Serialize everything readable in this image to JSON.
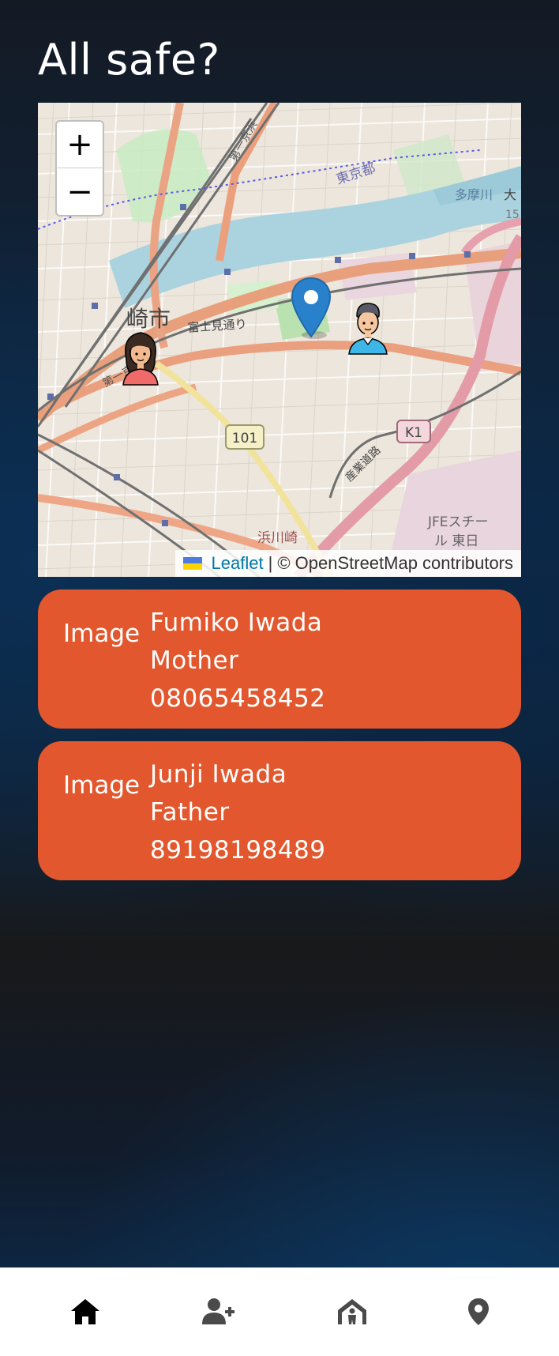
{
  "page": {
    "title": "All safe?"
  },
  "map": {
    "zoom_in_label": "+",
    "zoom_out_label": "−",
    "attribution": {
      "leaflet": "Leaflet",
      "separator": "|",
      "osm": "© OpenStreetMap contributors"
    },
    "labels": {
      "city": "崎市",
      "road_fuji": "富士見通り",
      "road_daiichi_a": "第一京浜",
      "road_daiichi_b": "第一京浜",
      "tokyo": "東京都",
      "tamagawa": "多摩川",
      "tamagawa_suffix": "大",
      "river_15": "15",
      "hamakawa": "浜川崎",
      "jfe_1": "JFEスチー",
      "jfe_2": "ル 東日",
      "route_101": "101",
      "route_k1": "K1",
      "sangyo": "産業道路"
    }
  },
  "contacts": [
    {
      "image_label": "Image",
      "name": "Fumiko Iwada",
      "relation": "Mother",
      "phone": "08065458452"
    },
    {
      "image_label": "Image",
      "name": "Junji Iwada",
      "relation": "Father",
      "phone": "89198198489"
    }
  ],
  "navbar": {
    "items": [
      {
        "icon": "home-icon",
        "active": true
      },
      {
        "icon": "add-user-icon",
        "active": false
      },
      {
        "icon": "shelter-icon",
        "active": false
      },
      {
        "icon": "location-pin-icon",
        "active": false
      }
    ]
  },
  "colors": {
    "card": "#e2572d",
    "navbar": "#ffffff",
    "marker_blue": "#2a81cb",
    "leaflet_link": "#0078a8"
  }
}
